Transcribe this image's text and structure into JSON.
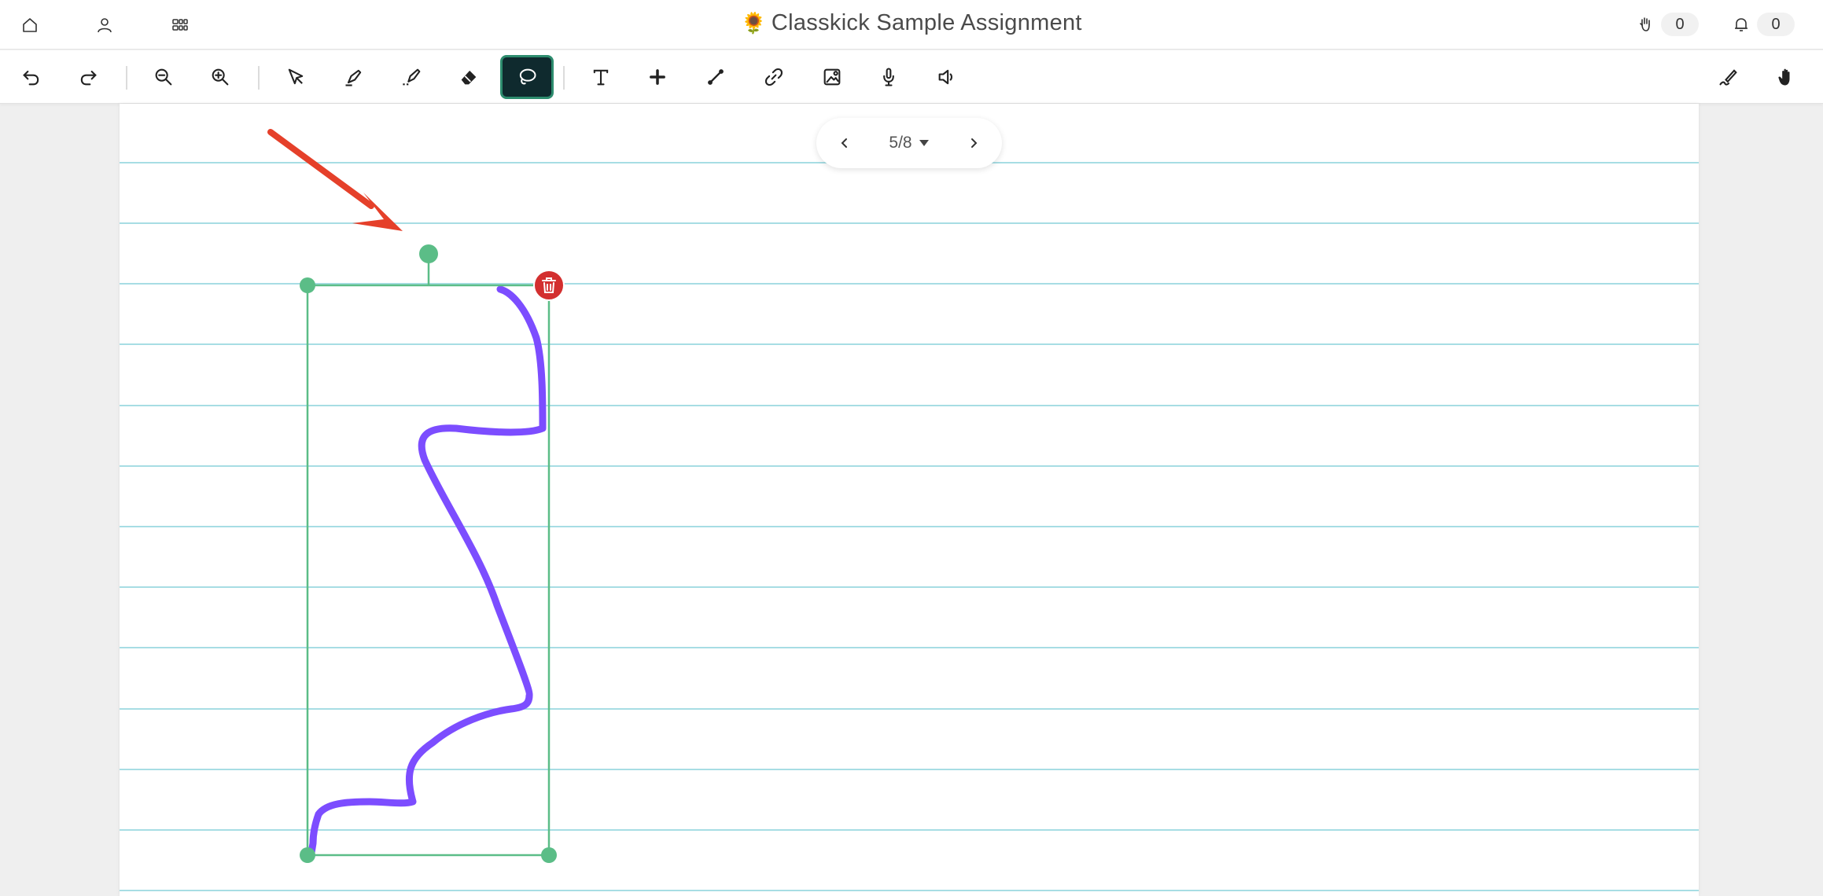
{
  "header": {
    "title_emoji": "🌻",
    "title": "Classkick Sample Assignment",
    "left_icons": [
      "home-icon",
      "profile-icon",
      "grid-icon"
    ],
    "hand_raise_count": "0",
    "notification_count": "0"
  },
  "toolbar": {
    "tools": [
      "undo",
      "redo",
      "zoom-out",
      "zoom-in",
      "pointer",
      "pen",
      "highlighter",
      "eraser",
      "lasso",
      "text",
      "add",
      "line",
      "link",
      "image",
      "record-audio",
      "play-audio",
      "pen-settings",
      "hand"
    ],
    "active_tool": "lasso",
    "active_bg": "#0f2a2e",
    "active_border": "#2d8c6e"
  },
  "pager": {
    "label": "5/8"
  },
  "canvas": {
    "line_color": "#a7dde4",
    "stroke_color": "#7c4dff",
    "selection_color": "#5bbd87",
    "delete_color": "#d32f2f",
    "arrow_color": "#e5402a"
  }
}
